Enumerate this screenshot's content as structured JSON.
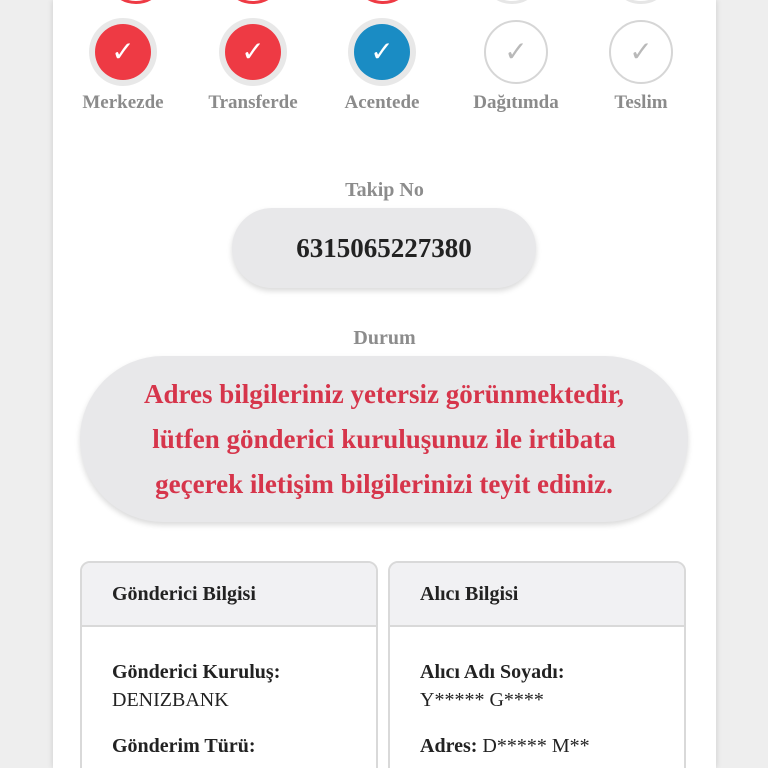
{
  "steps": [
    {
      "label": "Merkezde",
      "state": "done",
      "icon": "check-icon"
    },
    {
      "label": "Transferde",
      "state": "done",
      "icon": "check-icon"
    },
    {
      "label": "Acentede",
      "state": "current",
      "icon": "check-icon"
    },
    {
      "label": "Dağıtımda",
      "state": "pending",
      "icon": "check-icon"
    },
    {
      "label": "Teslim",
      "state": "pending",
      "icon": "check-icon"
    }
  ],
  "check_glyph": "✓",
  "tracking": {
    "label": "Takip No",
    "number": "6315065227380"
  },
  "status": {
    "label": "Durum",
    "message": "Adres bilgileriniz yetersiz görünmektedir, lütfen gönderici kuruluşunuz ile irtibata geçerek iletişim bilgilerinizi teyit ediniz."
  },
  "sender_card": {
    "title": "Gönderici Bilgisi",
    "org_label": "Gönderici Kuruluş:",
    "org_value": "DENIZBANK",
    "type_label": "Gönderim Türü:"
  },
  "receiver_card": {
    "title": "Alıcı Bilgisi",
    "name_label": "Alıcı Adı Soyadı:",
    "name_value": "Y***** G****",
    "address_label": "Adres:",
    "address_value": "D***** M**"
  },
  "colors": {
    "done": "#ee3a44",
    "current": "#1a8cc4",
    "pending_border": "#d6d6d6",
    "status_text": "#d6354b",
    "label_gray": "#8c8c8c"
  }
}
